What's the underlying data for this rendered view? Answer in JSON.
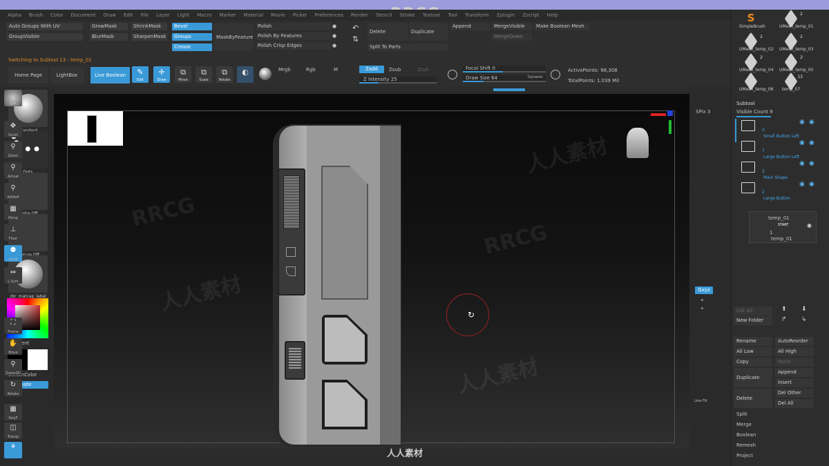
{
  "menu": [
    "Alpha",
    "Brush",
    "Color",
    "Document",
    "Draw",
    "Edit",
    "File",
    "Layer",
    "Light",
    "Macro",
    "Marker",
    "Material",
    "Movie",
    "Picker",
    "Preferences",
    "Render",
    "Stencil",
    "Stroke",
    "Texture",
    "Tool",
    "Transform",
    "Zplugin",
    "Zscript",
    "Help"
  ],
  "logo_text": "RRCG",
  "ribbon": {
    "auto_groups_uv": "Auto Groups With UV",
    "group_visible": "GroupVisible",
    "grow_mask": "GrowMask",
    "shrink_mask": "ShrinkMask",
    "blur_mask": "BlurMask",
    "sharpen_mask": "SharpenMask",
    "bevel": "Bevel",
    "groups": "Groups",
    "crease": "Crease",
    "mask_by_feature": "MaskByFeature",
    "polish": "Polish",
    "polish_by_features": "Polish By Features",
    "polish_crisp_edges": "Polish Crisp Edges",
    "delete": "Delete",
    "duplicate": "Duplicate",
    "split_to_parts": "Split To Parts",
    "append": "Append",
    "merge_visible": "MergeVisible",
    "merge_down": "MergeDown",
    "make_boolean_mesh": "Make Boolean Mesh",
    "status_text": "Switching to Subtool 13 : temp_01",
    "home_page": "Home Page",
    "lightbox": "LightBox",
    "live_boolean": "Live Boolean",
    "edit": "Edit",
    "draw": "Draw",
    "move": "Move",
    "scale": "Scale",
    "rotate": "Rotate",
    "mrgb": "Mrgb",
    "rgb": "Rgb",
    "m": "M",
    "zadd": "Zadd",
    "zsub": "Zsub",
    "zcut": "Zcut",
    "z_intensity": "Z Intensity 25",
    "focal_shift": "Focal Shift 0",
    "draw_size": "Draw Size 64",
    "dynamic": "Dynamic",
    "active_points": "ActivePoints: 98,308",
    "total_points": "TotalPoints: 1.039 Mil",
    "z_intensity_value": 25,
    "focal_shift_value": 0,
    "draw_size_value": 64
  },
  "left_shelf": {
    "standard": "Standard",
    "dots": "Dots",
    "alpha_off": "Alpha Off",
    "texture_off": "Texture Off",
    "material": "zbr_matcap_label",
    "gradient": "Gradient",
    "switch_color": "SwitchColor",
    "alternate": "Alternate"
  },
  "right_shelf": {
    "bpr": "BPR",
    "spix": "SPix 3",
    "scroll": "Scroll",
    "zoom": "Zoom",
    "actual": "Actual",
    "aahalf": "AAHalf",
    "persp": "Persp",
    "floor": "Floor",
    "local": "Local",
    "lsym": "L.Sym",
    "gxyz": "Gxyz",
    "frame": "Frame",
    "move": "Move",
    "zoom3d": "Zoom3D",
    "rotate": "Rotate",
    "line_fill": "Line Fill",
    "polyf": "PolyF",
    "transp": "Transp"
  },
  "tools": [
    {
      "name": "SimpleBrush",
      "count": ""
    },
    {
      "name": "UMesh_temp_01",
      "count": "2"
    },
    {
      "name": "UMesh_temp_02",
      "count": "2"
    },
    {
      "name": "UMesh_temp_03",
      "count": "2"
    },
    {
      "name": "UMesh_temp_04",
      "count": "2"
    },
    {
      "name": "UMesh_temp_05",
      "count": "2"
    },
    {
      "name": "UMesh_temp_06",
      "count": ""
    },
    {
      "name": "temp_07",
      "count": "13"
    }
  ],
  "subtool": {
    "title": "Subtool",
    "visible_count": "Visible Count 9",
    "items": [
      {
        "num": "3",
        "name": "Small Button Left"
      },
      {
        "num": "7",
        "name": "Large Button Left"
      },
      {
        "num": "5",
        "name": "Main Shape"
      },
      {
        "num": "2",
        "name": "Large Button"
      }
    ],
    "children": [
      "temp_01",
      "START",
      "temp_01"
    ],
    "child_num": "1"
  },
  "right_panel": {
    "list_all": "List All",
    "new_folder": "New Folder",
    "rename": "Rename",
    "auto_reorder": "AutoReorder",
    "all_low": "All Low",
    "all_high": "All High",
    "copy": "Copy",
    "paste": "Paste",
    "duplicate": "Duplicate",
    "append": "Append",
    "insert": "Insert",
    "delete": "Delete",
    "del_other": "Del Other",
    "del_all": "Del All",
    "split": "Split",
    "merge": "Merge",
    "boolean": "Boolean",
    "remesh": "Remesh",
    "project": "Project"
  },
  "watermark": {
    "site": "人人素材",
    "brand": "RRCG"
  },
  "colors": {
    "accent": "#3a9ad8",
    "subtool_text": "#44a8ee",
    "status_orange": "#e08a2a",
    "top_strip": "#9c9cdc"
  }
}
